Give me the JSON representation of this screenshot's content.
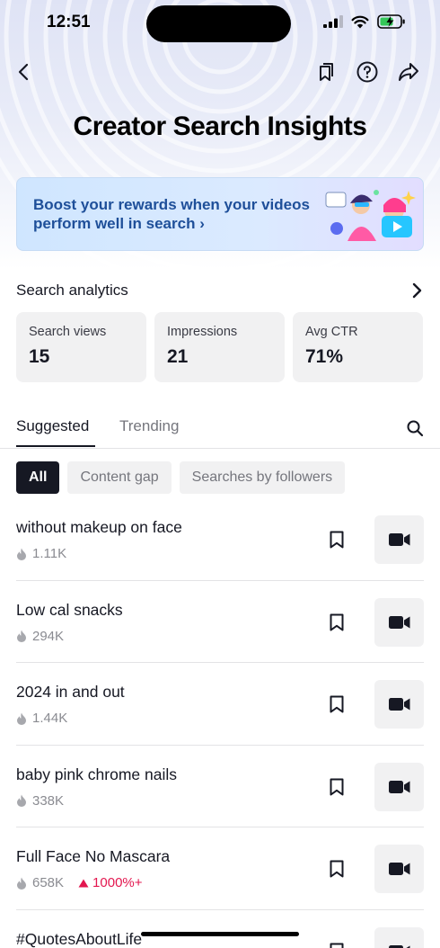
{
  "status_bar": {
    "time": "12:51"
  },
  "nav": {
    "back_icon": "chevron-left-icon",
    "bookmarks_icon": "bookmarks-icon",
    "help_icon": "help-circle-icon",
    "share_icon": "share-arrow-icon"
  },
  "page": {
    "title": "Creator Search Insights"
  },
  "banner": {
    "text": "Boost your rewards when your videos perform well in search",
    "chevron": "›",
    "bg_color": "#d6e8ff",
    "text_color": "#1e4f99"
  },
  "analytics": {
    "title": "Search analytics",
    "cards": [
      {
        "label": "Search views",
        "value": "15"
      },
      {
        "label": "Impressions",
        "value": "21"
      },
      {
        "label": "Avg CTR",
        "value": "71%"
      }
    ]
  },
  "tabs": [
    {
      "label": "Suggested",
      "active": true
    },
    {
      "label": "Trending",
      "active": false
    }
  ],
  "chips": [
    {
      "label": "All",
      "selected": true
    },
    {
      "label": "Content gap",
      "selected": false
    },
    {
      "label": "Searches by followers",
      "selected": false
    }
  ],
  "rows": [
    {
      "title": "without makeup on face",
      "count": "1.11K",
      "growth": ""
    },
    {
      "title": "Low cal snacks",
      "count": "294K",
      "growth": ""
    },
    {
      "title": "2024 in and out",
      "count": "1.44K",
      "growth": ""
    },
    {
      "title": "baby pink chrome nails",
      "count": "338K",
      "growth": ""
    },
    {
      "title": "Full Face No Mascara",
      "count": "658K",
      "growth": "1000%+"
    },
    {
      "title": "#QuotesAboutLife",
      "count": "",
      "growth": ""
    }
  ],
  "colors": {
    "accent": "#161823",
    "growth": "#e3174f",
    "card_bg": "#f1f1f2"
  }
}
